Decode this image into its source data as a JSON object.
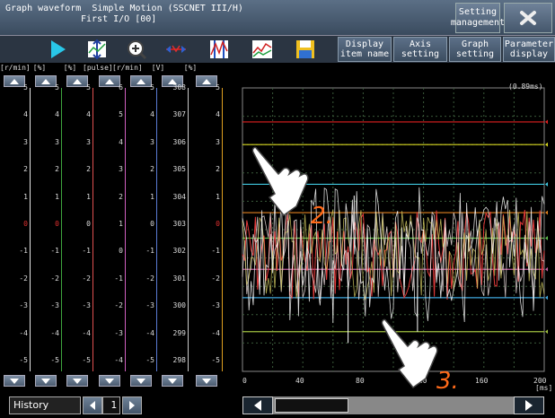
{
  "titlebar": {
    "title_line1": "Graph waveform  Simple Motion (SSCNET III/H)",
    "title_line2": "First I/O [00]",
    "setting_management": "Setting\nmanagement"
  },
  "toolbar": {
    "tools": [
      "run-icon",
      "vertical-scale-icon",
      "zoom-icon",
      "horizontal-scale-icon",
      "cursor-measure-icon",
      "waveform-display-icon",
      "save-icon"
    ],
    "display_item_name": "Display\nitem name",
    "axis_setting": "Axis\nsetting",
    "graph_setting": "Graph\nsetting",
    "parameter_display": "Parameter\ndisplay"
  },
  "units": [
    "[r/min]",
    "[%]",
    "[%]",
    "[pulse]",
    "[r/min]",
    "[V]",
    "[%]"
  ],
  "scales": [
    {
      "color": "#e8e8e8",
      "ticks": [
        "5",
        "4",
        "3",
        "2",
        "1",
        "0",
        "-1",
        "-2",
        "-3",
        "-4",
        "-5"
      ],
      "zero_red": true
    },
    {
      "color": "#3da43d",
      "ticks": [
        "5",
        "4",
        "3",
        "2",
        "1",
        "0",
        "-1",
        "-2",
        "-3",
        "-4",
        "-5"
      ],
      "zero_red": true
    },
    {
      "color": "#e05050",
      "ticks": [
        "5",
        "4",
        "3",
        "2",
        "1",
        "0",
        "-1",
        "-2",
        "-3",
        "-4",
        "-5"
      ],
      "zero_red": false
    },
    {
      "color": "#d060c0",
      "ticks": [
        "6",
        "5",
        "4",
        "3",
        "2",
        "1",
        "0",
        "-1",
        "-2",
        "-3",
        "-4"
      ],
      "zero_red": false
    },
    {
      "color": "#5b7bd5",
      "ticks": [
        "5",
        "4",
        "3",
        "2",
        "1",
        "0",
        "-1",
        "-2",
        "-3",
        "-4",
        "-5"
      ],
      "zero_red": false
    },
    {
      "color": "#c8c8c8",
      "ticks": [
        "308",
        "307",
        "306",
        "305",
        "304",
        "303",
        "302",
        "301",
        "300",
        "299",
        "298"
      ],
      "zero_red": false
    },
    {
      "color": "#e0a020",
      "ticks": [
        "5",
        "4",
        "3",
        "2",
        "1",
        "0",
        "-1",
        "-2",
        "-3",
        "-4",
        "-5"
      ],
      "zero_red": true
    }
  ],
  "plot": {
    "time_readout": "(0.89ms)",
    "x_ticks": [
      "0",
      "40",
      "80",
      "120",
      "160",
      "200"
    ],
    "x_unit": "[ms]",
    "guide_colors": [
      "#e02020",
      "#d8d820",
      "#40c8e0",
      "#e08020",
      "#60c050",
      "#c060a0",
      "#40a8e0",
      "#a0c040"
    ]
  },
  "history": {
    "label": "History",
    "value": "1"
  },
  "annotations": {
    "step2": "2.",
    "step3": "3."
  }
}
